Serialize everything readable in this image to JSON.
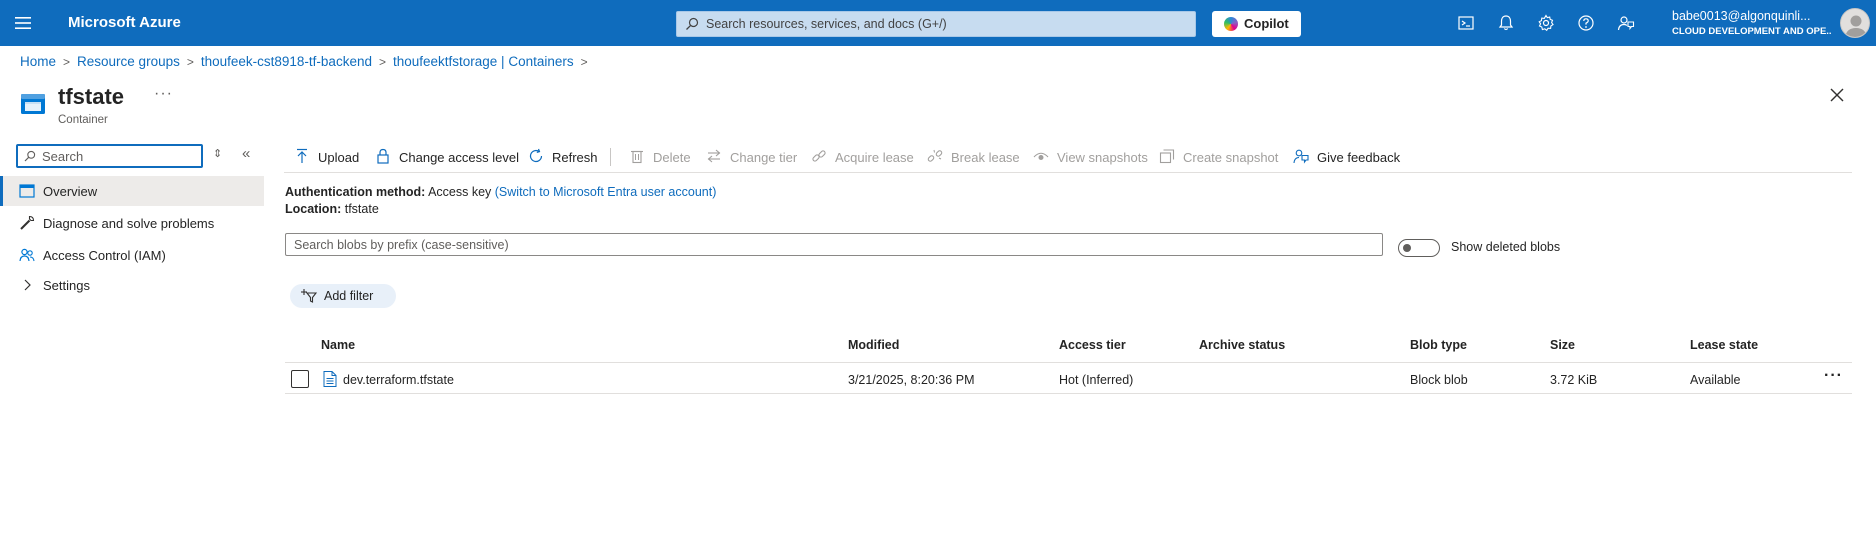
{
  "topbar": {
    "brand": "Microsoft Azure",
    "search_placeholder": "Search resources, services, and docs (G+/)",
    "copilot_label": "Copilot",
    "user_email": "babe0013@algonquinli...",
    "user_org": "CLOUD DEVELOPMENT AND OPE...",
    "icons": [
      "cloud-shell-icon",
      "bell-icon",
      "gear-icon",
      "help-icon",
      "feedback-icon"
    ]
  },
  "breadcrumb": {
    "items": [
      "Home",
      "Resource groups",
      "thoufeek-cst8918-tf-backend",
      "thoufeektfstorage | Containers"
    ],
    "separator": ">"
  },
  "page": {
    "title": "tfstate",
    "more": "···",
    "subtitle": "Container"
  },
  "nav": {
    "search_placeholder": "Search",
    "items": [
      {
        "label": "Overview",
        "icon": "overview-icon",
        "active": true
      },
      {
        "label": "Diagnose and solve problems",
        "icon": "wrench-icon",
        "active": false
      },
      {
        "label": "Access Control (IAM)",
        "icon": "people-icon",
        "active": false
      },
      {
        "label": "Settings",
        "icon": "chevron-right-icon",
        "active": false
      }
    ]
  },
  "toolbar": {
    "upload": "Upload",
    "change_access_level": "Change access level",
    "refresh": "Refresh",
    "delete": "Delete",
    "change_tier": "Change tier",
    "acquire_lease": "Acquire lease",
    "break_lease": "Break lease",
    "view_snapshots": "View snapshots",
    "create_snapshot": "Create snapshot",
    "give_feedback": "Give feedback"
  },
  "info": {
    "auth_label": "Authentication method:",
    "auth_value": "Access key",
    "auth_link": "(Switch to Microsoft Entra user account)",
    "location_label": "Location:",
    "location_value": "tfstate"
  },
  "blobs": {
    "search_placeholder": "Search blobs by prefix (case-sensitive)",
    "show_deleted_label": "Show deleted blobs",
    "add_filter_label": "Add filter",
    "columns": [
      "Name",
      "Modified",
      "Access tier",
      "Archive status",
      "Blob type",
      "Size",
      "Lease state"
    ],
    "rows": [
      {
        "name": "dev.terraform.tfstate",
        "modified": "3/21/2025, 8:20:36 PM",
        "access_tier": "Hot (Inferred)",
        "archive_status": "",
        "blob_type": "Block blob",
        "size": "3.72 KiB",
        "lease_state": "Available"
      }
    ],
    "row_more": "···"
  },
  "colors": {
    "accent": "#0f6cbd",
    "nav_active_bg": "#edebe9",
    "disabled_text": "#a19f9d"
  }
}
